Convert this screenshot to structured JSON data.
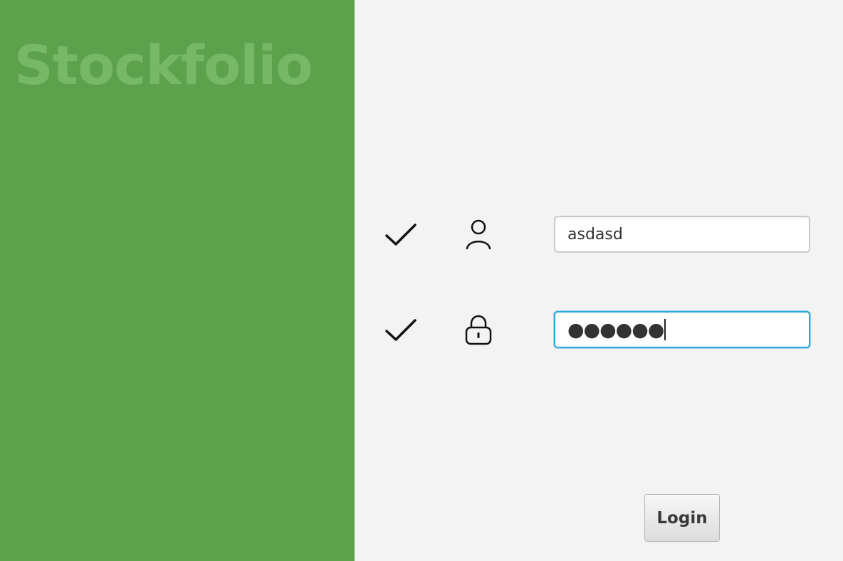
{
  "brand": {
    "title": "Stockfolio",
    "panel_color": "#5ca24c",
    "title_color": "#76b866"
  },
  "form": {
    "username": {
      "value": "asdasd",
      "valid": true,
      "icon": "user-icon"
    },
    "password": {
      "masked_value": "●●●●●●",
      "valid": true,
      "focused": true,
      "icon": "lock-icon"
    },
    "login_button": {
      "label": "Login"
    },
    "colors": {
      "focus_border": "#29a8e0",
      "background": "#f3f3f3"
    }
  }
}
